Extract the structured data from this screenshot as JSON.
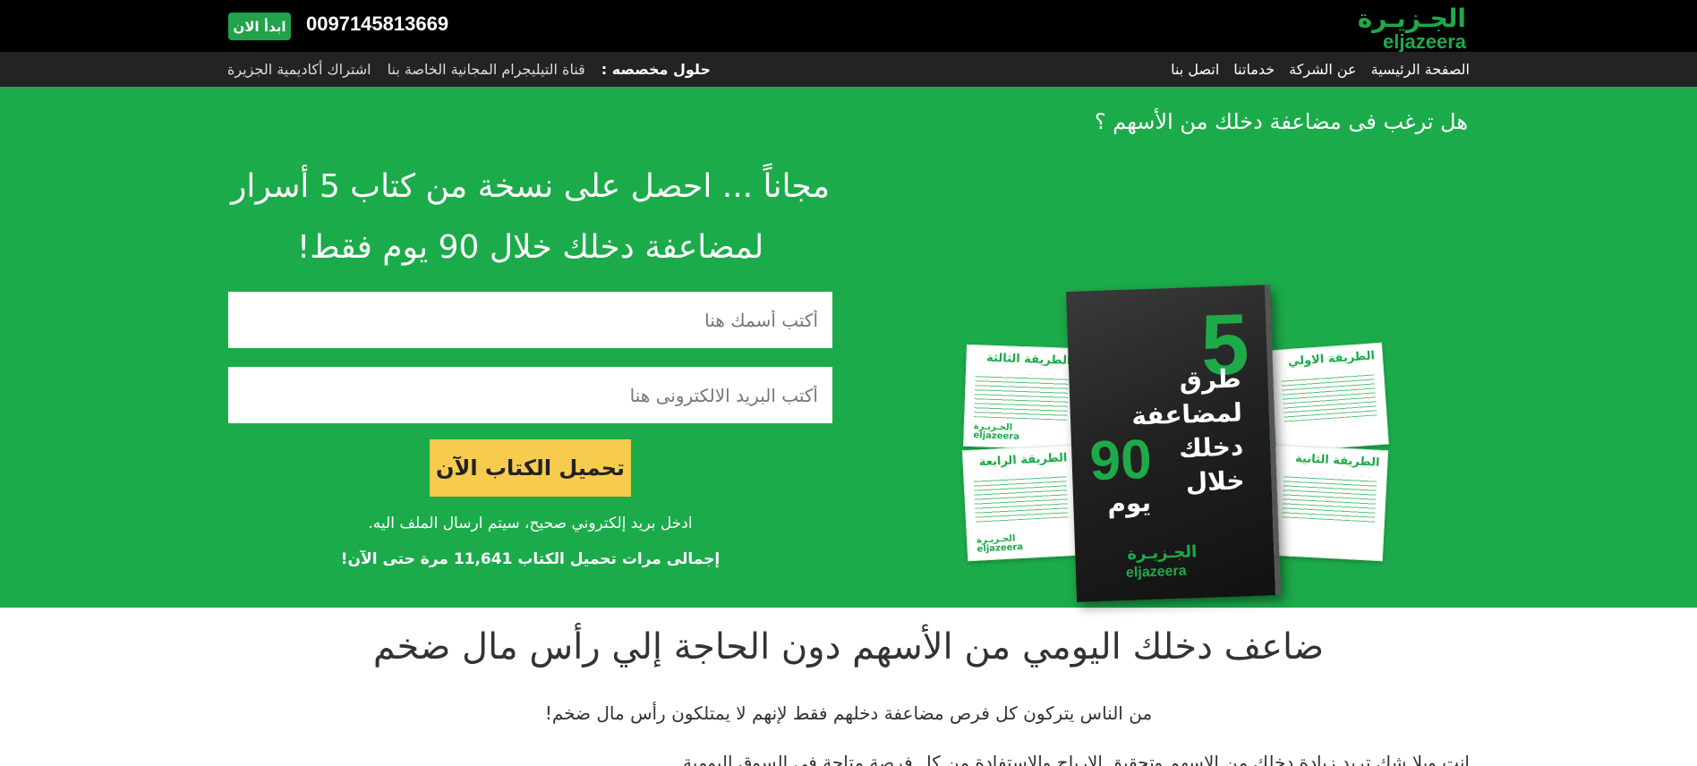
{
  "brand": {
    "name_ar": "الجـزيـرة",
    "name_en": "eljazeera",
    "color": "#1cab4a"
  },
  "topbar": {
    "phone": "0097145813669",
    "start_label": "ابدأ الان"
  },
  "nav": {
    "main": [
      "الصفحة الرئيسية",
      "عن الشركة",
      "خدماتنا",
      "اتصل بنا"
    ],
    "custom_label": "حلول مخصصه :",
    "custom_links": [
      "قناة التيليجرام المجانية الخاصة بنا",
      "اشتراك أكاديمية الجزيرة"
    ]
  },
  "hero": {
    "question": "هل ترغب فى مضاعفة دخلك من الأسهم ؟",
    "headline": "مجاناً ... احصل على نسخة من كتاب 5 أسرار لمضاعفة دخلك خلال 90 يوم فقط!",
    "name_placeholder": "أكتب أسمك هنا",
    "email_placeholder": "أكتب البريد الالكترونى هنا",
    "button_label": "تحميل الكتاب الآن",
    "hint": "ادخل بريد إلكتروني صحيح، سيتم ارسال الملف اليه.",
    "counter": "إجمالى مرات تحميل الكتاب 11,641 مرة حتى الآن!"
  },
  "book": {
    "number": "5",
    "title_lines": [
      "طرق",
      "لمضاعفة",
      "دخلك",
      "خلال"
    ],
    "days_number": "90",
    "days_word": "يوم",
    "logo_ar": "الجـزيـرة",
    "logo_en": "eljazeera",
    "sheets": [
      "الطريقة الثالثة",
      "الطريقة الرابعة",
      "الطريقة الاولي",
      "الطريقة الثانية"
    ],
    "sheet_logo_ar": "الجـزيـرة",
    "sheet_logo_en": "eljazeera"
  },
  "section": {
    "title": "ضاعف دخلك اليومي من الأسهم دون الحاجة إلي رأس مال ضخم",
    "subtitle": "من الناس يتركون كل فرص مضاعفة دخلهم فقط لإنهم لا يمتلكون رأس مال ضخم!",
    "cut_text": "انت وبلا شك تريد زيادة دخلك من الاسهم وتحقيق الارباح والاستفادة من كل فرصة متاحة في السوق اليومية"
  }
}
